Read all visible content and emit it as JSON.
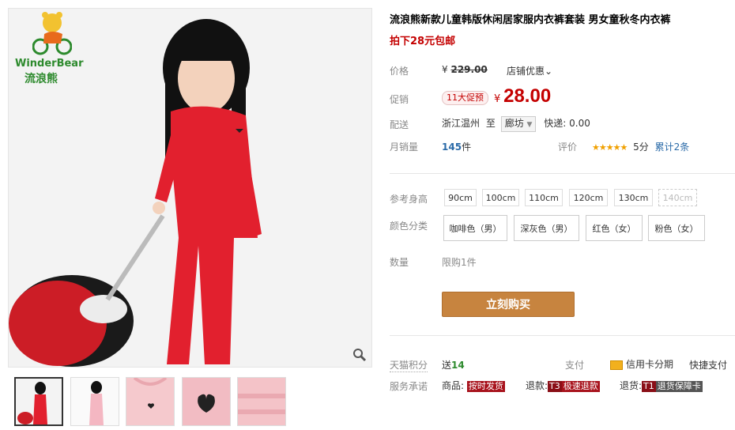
{
  "brand": {
    "logo_en": "WinderBear",
    "logo_cn": "流浪熊"
  },
  "product": {
    "title": "流浪熊新款儿童韩版休闲居家服内衣裤套装 男女童秋冬内衣裤",
    "subtitle": "拍下28元包邮"
  },
  "price": {
    "label": "价格",
    "currency": "¥",
    "original": "229.00",
    "shop_discount": "店铺优惠",
    "promo_label": "促销",
    "promo_badge": "11大促预",
    "promo_currency": "¥",
    "promo_price": "28.00"
  },
  "shipping": {
    "label": "配送",
    "from": "浙江温州",
    "to_word": "至",
    "destination": "廊坊",
    "express": "快递: 0.00"
  },
  "sales": {
    "label": "月销量",
    "count": "145",
    "unit": "件",
    "rating_label": "评价",
    "stars": "★★★★★",
    "score": "5分",
    "reviews": "累计2条"
  },
  "size": {
    "label": "参考身高",
    "options": [
      "90cm",
      "100cm",
      "110cm",
      "120cm",
      "130cm",
      "140cm"
    ]
  },
  "color": {
    "label": "颜色分类",
    "options": [
      "咖啡色（男）",
      "深灰色（男）",
      "红色（女）",
      "粉色（女）"
    ]
  },
  "quantity": {
    "label": "数量",
    "limit": "限购1件"
  },
  "buy_button": "立刻购买",
  "points": {
    "label": "天猫积分",
    "value_prefix": "送",
    "value": "14",
    "pay_label": "支付",
    "credit_label": "信用卡分期",
    "quick_pay": "快捷支付"
  },
  "service": {
    "label": "服务承诺",
    "goods_label": "商品:",
    "goods_tag": "按时发货",
    "refund_label": "退款:",
    "refund_code": "T3",
    "refund_tag": "极速退款",
    "return_label": "退货:",
    "return_code": "T1",
    "return_tag": "退货保障卡"
  },
  "colors": {
    "accent": "#c40000",
    "buy": "#c7843f",
    "tmall_red": "#a8131d"
  }
}
